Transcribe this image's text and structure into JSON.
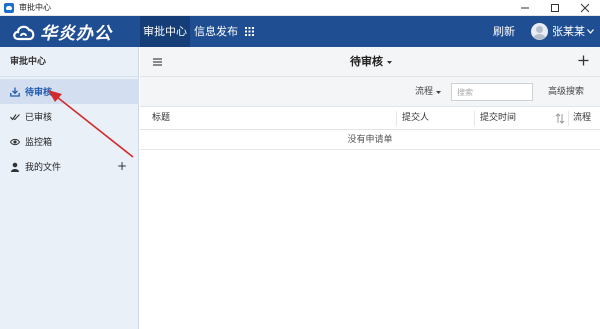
{
  "window": {
    "title": "审批中心"
  },
  "topbar": {
    "brand": "华炎办公",
    "nav": [
      "审批中心",
      "信息发布"
    ],
    "refresh_label": "刷新",
    "user_name": "张某某"
  },
  "sidebar": {
    "header": "审批中心",
    "items": [
      {
        "label": "待审核",
        "icon": "download-tray-icon",
        "active": true
      },
      {
        "label": "已审核",
        "icon": "double-check-icon",
        "active": false
      },
      {
        "label": "监控箱",
        "icon": "eye-icon",
        "active": false
      },
      {
        "label": "我的文件",
        "icon": "user-icon",
        "active": false
      }
    ],
    "add_label": "+"
  },
  "main": {
    "view_title": "待审核",
    "flow_filter": "流程",
    "search_placeholder": "搜索",
    "advanced_search": "高级搜索",
    "columns": [
      "标题",
      "提交人",
      "提交时间",
      "流程"
    ],
    "empty_text": "没有申请单"
  },
  "colors": {
    "topbar": "#1f4e92",
    "nav_active": "#153e78",
    "sidebar_bg": "#eaf0f8",
    "sidebar_active": "#d3dff0",
    "annotation_arrow": "#d22b2b"
  }
}
